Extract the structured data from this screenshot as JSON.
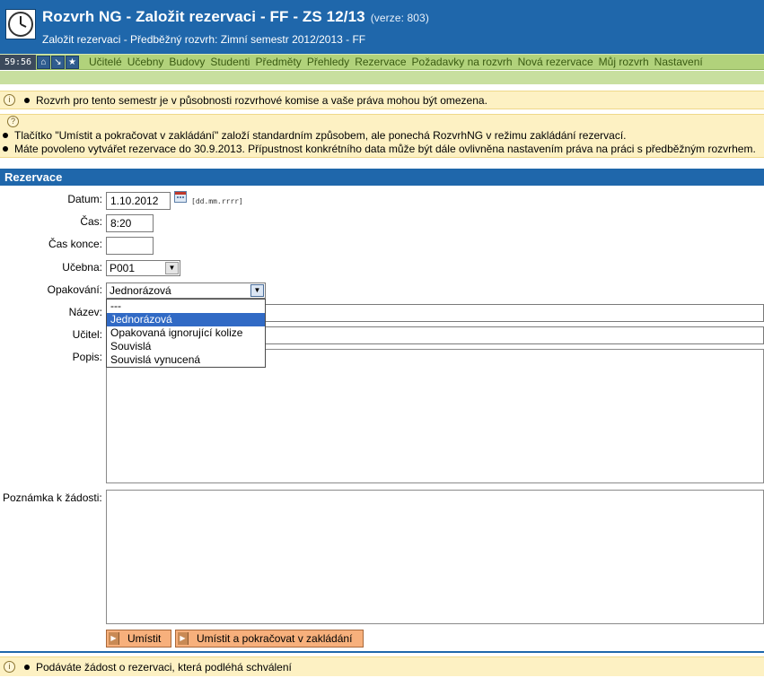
{
  "header": {
    "title": "Rozvrh NG - Založit rezervaci - FF - ZS 12/13",
    "version": "(verze: 803)",
    "subtitle": "Založit rezervaci - Předběžný rozvrh: Zimní semestr 2012/2013 - FF"
  },
  "menu": {
    "timer": "59:56",
    "items": [
      "Učitelé",
      "Učebny",
      "Budovy",
      "Studenti",
      "Předměty",
      "Přehledy",
      "Rezervace",
      "Požadavky na rozvrh",
      "Nová rezervace",
      "Můj rozvrh",
      "Nastavení"
    ]
  },
  "notices": {
    "info": "Rozvrh pro tento semestr je v působnosti rozvrhové komise a vaše práva mohou být omezena.",
    "hint1": "Tlačítko \"Umístit a pokračovat v zakládání\" založí standardním způsobem, ale ponechá RozvrhNG v režimu zakládání rezervací.",
    "hint2": "Máte povoleno vytvářet rezervace do 30.9.2013. Přípustnost konkrétního data může být dále ovlivněna nastavením práva na práci s předběžným rozvrhem.",
    "bottom": "Podáváte žádost o rezervaci, která podléhá schválení"
  },
  "form": {
    "section_title": "Rezervace",
    "datum_label": "Datum:",
    "datum_value": "1.10.2012",
    "datum_format": "[dd.mm.rrrr]",
    "cas_label": "Čas:",
    "cas_value": "8:20",
    "cas_konce_label": "Čas konce:",
    "cas_konce_value": "",
    "ucebna_label": "Učebna:",
    "ucebna_value": "P001",
    "opakovani_label": "Opakování:",
    "opakovani_value": "Jednorázová",
    "opakovani_options": [
      "---",
      "Jednorázová",
      "Opakovaná ignorující kolize",
      "Souvislá",
      "Souvislá vynucená"
    ],
    "nazev_label": "Název:",
    "ucitel_label": "Učitel:",
    "popis_label": "Popis:",
    "poznamka_label": "Poznámka k žádosti:"
  },
  "buttons": {
    "place": "Umístit",
    "place_continue": "Umístit a pokračovat v zakládání"
  }
}
